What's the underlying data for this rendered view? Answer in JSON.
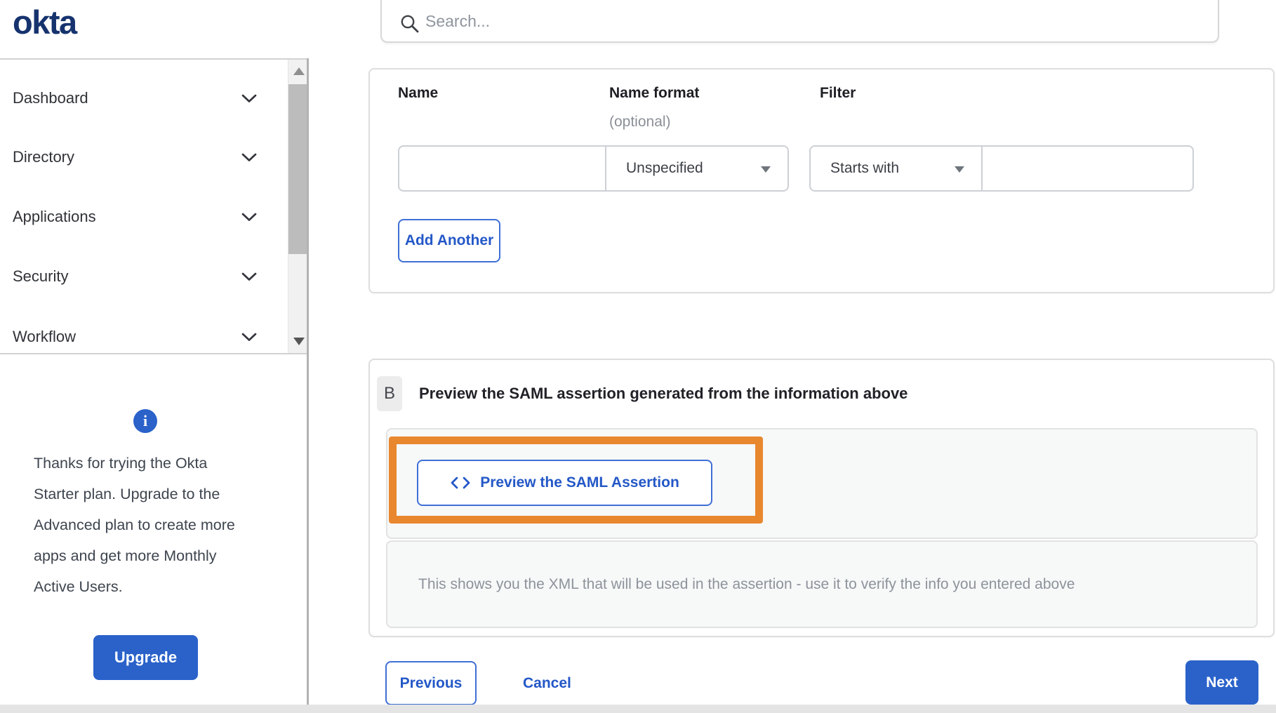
{
  "colors": {
    "brand_navy": "#16336e",
    "accent_blue": "#2a62ca",
    "link_blue": "#2458c7",
    "highlight_orange": "#e8872e"
  },
  "brand": {
    "logo_text": "okta"
  },
  "search": {
    "placeholder": "Search...",
    "value": "",
    "icon": "search-icon"
  },
  "sidebar": {
    "items": [
      {
        "label": "Dashboard"
      },
      {
        "label": "Directory"
      },
      {
        "label": "Applications"
      },
      {
        "label": "Security"
      },
      {
        "label": "Workflow"
      }
    ],
    "notice": {
      "icon": "info-icon",
      "text": "Thanks for trying the Okta Starter plan. Upgrade to the Advanced plan to create more apps and get more Monthly Active Users.",
      "upgrade_label": "Upgrade"
    }
  },
  "attribute_form": {
    "name_label": "Name",
    "name_format_label": "Name format",
    "name_format_hint": "(optional)",
    "filter_label": "Filter",
    "row": {
      "name_value": "",
      "name_format_value": "Unspecified",
      "filter_type_value": "Starts with",
      "filter_value": ""
    },
    "add_another_label": "Add Another"
  },
  "preview_section": {
    "step_badge": "B",
    "heading": "Preview the SAML assertion generated from the information above",
    "code_icon": "code-brackets-icon",
    "preview_button_label": "Preview the SAML Assertion",
    "description": "This shows you the XML that will be used in the assertion - use it to verify the info you entered above"
  },
  "footer": {
    "previous_label": "Previous",
    "cancel_label": "Cancel",
    "next_label": "Next"
  }
}
